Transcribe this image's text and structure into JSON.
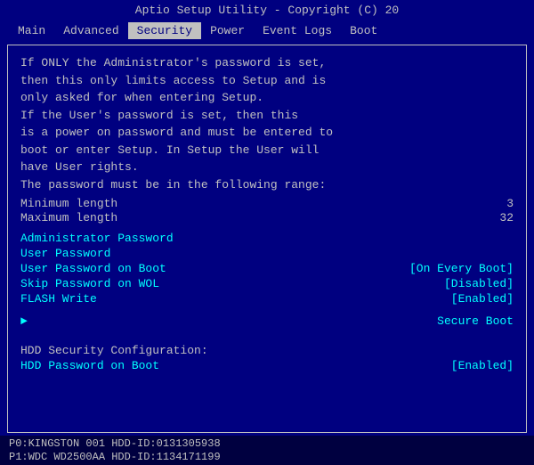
{
  "title_bar": {
    "text": "Aptio Setup Utility - Copyright (C) 20"
  },
  "nav": {
    "items": [
      {
        "id": "main",
        "label": "Main",
        "active": false
      },
      {
        "id": "advanced",
        "label": "Advanced",
        "active": false
      },
      {
        "id": "security",
        "label": "Security",
        "active": true
      },
      {
        "id": "power",
        "label": "Power",
        "active": false
      },
      {
        "id": "event_logs",
        "label": "Event Logs",
        "active": false
      },
      {
        "id": "boot",
        "label": "Boot",
        "active": false
      }
    ]
  },
  "description": {
    "lines": [
      "If ONLY the Administrator's password is set,",
      "then this only limits access to Setup and is",
      "only asked for when entering Setup.",
      "If the User's password is set, then this",
      "is a power on password and must be entered to",
      "boot or enter Setup. In Setup the User will",
      "have User rights.",
      "The password must be in the following range:"
    ]
  },
  "range": {
    "minimum_label": "Minimum length",
    "minimum_value": "3",
    "maximum_label": "Maximum length",
    "maximum_value": "32"
  },
  "menu_items": [
    {
      "id": "admin_password",
      "label": "Administrator Password",
      "value": "",
      "has_arrow": false
    },
    {
      "id": "user_password",
      "label": "User Password",
      "value": "",
      "has_arrow": false
    },
    {
      "id": "user_password_on_boot",
      "label": "User Password on Boot",
      "value": "[On Every Boot]",
      "has_arrow": false
    },
    {
      "id": "skip_password_on_wol",
      "label": "Skip Password on WOL",
      "value": "[Disabled]",
      "has_arrow": false
    },
    {
      "id": "flash_write",
      "label": "FLASH Write",
      "value": "[Enabled]",
      "has_arrow": false
    }
  ],
  "secure_boot": {
    "label": "Secure Boot",
    "has_arrow": true
  },
  "hdd_section": {
    "header": "HDD Security Configuration:",
    "item_label": "HDD Password on Boot",
    "item_value": "[Enabled]"
  },
  "bottom_items": [
    "P0:KINGSTON  001  HDD-ID:0131305938",
    "P1:WDC WD2500AA  HDD-ID:1134171199"
  ]
}
